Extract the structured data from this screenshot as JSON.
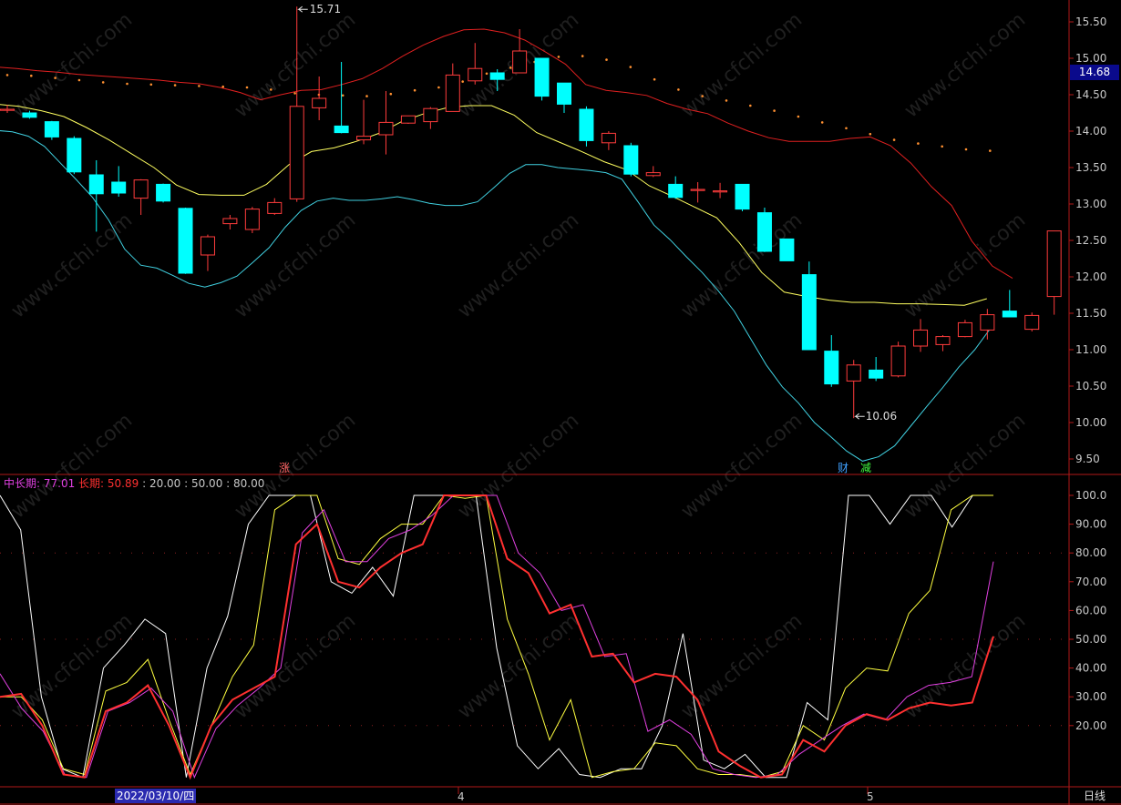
{
  "chart_data": [
    {
      "type": "candlestick",
      "y_ticks": [
        "9.50",
        "10.00",
        "10.50",
        "11.00",
        "11.50",
        "12.00",
        "12.50",
        "13.00",
        "13.50",
        "14.00",
        "14.50",
        "15.00",
        "15.50"
      ],
      "ylim": [
        9.3,
        15.75
      ],
      "current_price": "14.68",
      "annotations": {
        "high_label": "15.71",
        "low_label": "10.06"
      },
      "event_markers": [
        "涨",
        "财",
        "减"
      ],
      "colors": {
        "up": "#ff3c3c",
        "down": "#00ffff",
        "upper_band": "#e02020",
        "mid_line": "#ffff60",
        "lower_band": "#40d0e0",
        "dots": "#ff9030"
      },
      "candles": [
        {
          "o": 14.3,
          "h": 14.36,
          "l": 14.25,
          "c": 14.3
        },
        {
          "o": 14.25,
          "h": 14.28,
          "l": 14.17,
          "c": 14.19
        },
        {
          "o": 14.13,
          "h": 14.14,
          "l": 13.88,
          "c": 13.92
        },
        {
          "o": 13.9,
          "h": 13.93,
          "l": 13.41,
          "c": 13.44
        },
        {
          "o": 13.4,
          "h": 13.6,
          "l": 12.62,
          "c": 13.14
        },
        {
          "o": 13.3,
          "h": 13.52,
          "l": 13.1,
          "c": 13.15
        },
        {
          "o": 13.08,
          "h": 13.34,
          "l": 12.85,
          "c": 13.33
        },
        {
          "o": 13.27,
          "h": 13.28,
          "l": 13.02,
          "c": 13.04
        },
        {
          "o": 12.94,
          "h": 12.95,
          "l": 12.04,
          "c": 12.05
        },
        {
          "o": 12.3,
          "h": 12.58,
          "l": 12.08,
          "c": 12.55
        },
        {
          "o": 12.73,
          "h": 12.85,
          "l": 12.65,
          "c": 12.8
        },
        {
          "o": 12.65,
          "h": 12.96,
          "l": 12.6,
          "c": 12.93
        },
        {
          "o": 12.87,
          "h": 13.08,
          "l": 12.85,
          "c": 13.02
        },
        {
          "o": 13.07,
          "h": 15.71,
          "l": 13.03,
          "c": 14.34
        },
        {
          "o": 14.32,
          "h": 14.75,
          "l": 14.15,
          "c": 14.45
        },
        {
          "o": 14.07,
          "h": 14.95,
          "l": 13.97,
          "c": 13.98
        },
        {
          "o": 13.88,
          "h": 14.43,
          "l": 13.82,
          "c": 13.93
        },
        {
          "o": 13.95,
          "h": 14.55,
          "l": 13.68,
          "c": 14.12
        },
        {
          "o": 14.11,
          "h": 14.21,
          "l": 14.1,
          "c": 14.21
        },
        {
          "o": 14.13,
          "h": 14.33,
          "l": 14.03,
          "c": 14.31
        },
        {
          "o": 14.27,
          "h": 14.93,
          "l": 14.27,
          "c": 14.77
        },
        {
          "o": 14.69,
          "h": 15.21,
          "l": 14.64,
          "c": 14.86
        },
        {
          "o": 14.8,
          "h": 14.85,
          "l": 14.55,
          "c": 14.71
        },
        {
          "o": 14.8,
          "h": 15.4,
          "l": 14.8,
          "c": 15.1
        },
        {
          "o": 15.0,
          "h": 15.0,
          "l": 14.42,
          "c": 14.48
        },
        {
          "o": 14.66,
          "h": 14.66,
          "l": 14.25,
          "c": 14.37
        },
        {
          "o": 14.3,
          "h": 14.34,
          "l": 13.79,
          "c": 13.87
        },
        {
          "o": 13.84,
          "h": 14.0,
          "l": 13.74,
          "c": 13.97
        },
        {
          "o": 13.8,
          "h": 13.84,
          "l": 13.38,
          "c": 13.41
        },
        {
          "o": 13.39,
          "h": 13.52,
          "l": 13.37,
          "c": 13.43
        },
        {
          "o": 13.27,
          "h": 13.38,
          "l": 13.07,
          "c": 13.09
        },
        {
          "o": 13.2,
          "h": 13.3,
          "l": 13.02,
          "c": 13.2
        },
        {
          "o": 13.18,
          "h": 13.29,
          "l": 13.08,
          "c": 13.18
        },
        {
          "o": 13.27,
          "h": 13.27,
          "l": 12.9,
          "c": 12.93
        },
        {
          "o": 12.88,
          "h": 12.95,
          "l": 12.34,
          "c": 12.35
        },
        {
          "o": 12.52,
          "h": 12.52,
          "l": 12.22,
          "c": 12.22
        },
        {
          "o": 12.03,
          "h": 12.21,
          "l": 11.0,
          "c": 11.0
        },
        {
          "o": 10.98,
          "h": 11.2,
          "l": 10.49,
          "c": 10.53
        },
        {
          "o": 10.57,
          "h": 10.86,
          "l": 10.06,
          "c": 10.79
        },
        {
          "o": 10.72,
          "h": 10.9,
          "l": 10.57,
          "c": 10.61
        },
        {
          "o": 10.64,
          "h": 11.11,
          "l": 10.62,
          "c": 11.05
        },
        {
          "o": 11.05,
          "h": 11.42,
          "l": 10.97,
          "c": 11.27
        },
        {
          "o": 11.07,
          "h": 11.2,
          "l": 10.98,
          "c": 11.18
        },
        {
          "o": 11.18,
          "h": 11.41,
          "l": 11.17,
          "c": 11.37
        },
        {
          "o": 11.27,
          "h": 11.56,
          "l": 11.14,
          "c": 11.48
        },
        {
          "o": 11.53,
          "h": 11.82,
          "l": 11.45,
          "c": 11.45
        },
        {
          "o": 11.28,
          "h": 11.51,
          "l": 11.25,
          "c": 11.47
        },
        {
          "o": 11.73,
          "h": 12.63,
          "l": 11.48,
          "c": 12.63
        }
      ],
      "upper_band": [
        14.88,
        14.86,
        14.83,
        14.81,
        14.78,
        14.76,
        14.74,
        14.72,
        14.7,
        14.67,
        14.65,
        14.6,
        14.53,
        14.43,
        14.5,
        14.56,
        14.57,
        14.64,
        14.72,
        14.86,
        15.03,
        15.18,
        15.3,
        15.39,
        15.4,
        15.35,
        15.25,
        15.09,
        14.92,
        14.64,
        14.56,
        14.53,
        14.49,
        14.38,
        14.3,
        14.24,
        14.11,
        14.0,
        13.91,
        13.86,
        13.86,
        13.86,
        13.9,
        13.92,
        13.8,
        13.56,
        13.24,
        12.98,
        12.49,
        12.15,
        11.98
      ],
      "mid_line": [
        14.37,
        14.34,
        14.28,
        14.2,
        14.05,
        13.88,
        13.69,
        13.5,
        13.26,
        13.13,
        13.12,
        13.12,
        13.27,
        13.54,
        13.72,
        13.77,
        13.86,
        13.97,
        14.13,
        14.24,
        14.32,
        14.35,
        14.35,
        14.22,
        13.98,
        13.85,
        13.72,
        13.58,
        13.47,
        13.25,
        13.11,
        12.96,
        12.81,
        12.47,
        12.06,
        11.79,
        11.73,
        11.68,
        11.65,
        11.65,
        11.63,
        11.63,
        11.62,
        11.61,
        11.7
      ],
      "lower_band": [
        14.01,
        13.99,
        13.93,
        13.79,
        13.56,
        13.33,
        13.09,
        12.78,
        12.38,
        12.16,
        12.12,
        12.02,
        11.91,
        11.86,
        11.92,
        12.01,
        12.2,
        12.4,
        12.68,
        12.91,
        13.04,
        13.08,
        13.05,
        13.05,
        13.07,
        13.1,
        13.06,
        13.01,
        12.98,
        12.98,
        13.03,
        13.22,
        13.42,
        13.54,
        13.54,
        13.5,
        13.48,
        13.46,
        13.43,
        13.34,
        13.03,
        12.71,
        12.51,
        12.28,
        12.06,
        11.81,
        11.53,
        11.16,
        10.79,
        10.49,
        10.27,
        10.0,
        9.81,
        9.61,
        9.47,
        9.53,
        9.68,
        9.95,
        10.22,
        10.48,
        10.76,
        11.0,
        11.3
      ],
      "dot_line": [
        14.77,
        14.76,
        14.73,
        14.7,
        14.67,
        14.65,
        14.64,
        14.63,
        14.62,
        14.61,
        14.6,
        14.57,
        14.52,
        14.5,
        14.49,
        14.48,
        14.51,
        14.56,
        14.6,
        14.68,
        14.79,
        14.87,
        14.95,
        15.02,
        15.03,
        14.98,
        14.88,
        14.71,
        14.57,
        14.48,
        14.42,
        14.35,
        14.28,
        14.2,
        14.12,
        14.04,
        13.96,
        13.88,
        13.83,
        13.79,
        13.75,
        13.73
      ]
    },
    {
      "type": "line",
      "y_ticks": [
        "20.00",
        "30.00",
        "40.00",
        "50.00",
        "60.00",
        "70.00",
        "80.00",
        "90.00",
        "100.0"
      ],
      "ylim": [
        0,
        104
      ],
      "legend": [
        {
          "label": "中长期: 77.01",
          "color": "#e040e0"
        },
        {
          "label": "长期: 50.89",
          "color": "#ff3030"
        },
        {
          "label": ": 20.00 : 50.00 : 80.00",
          "color": "#c8c8c8"
        }
      ],
      "series": [
        {
          "color": "#ffffff",
          "width": 1,
          "values": [
            100,
            88,
            30,
            5,
            2,
            40,
            48,
            57,
            52,
            2,
            40,
            58,
            90,
            100,
            100,
            100,
            70,
            66,
            75,
            65,
            100,
            100,
            100,
            100,
            47,
            13,
            5,
            12,
            3,
            2,
            5,
            5,
            20,
            52,
            8,
            5,
            10,
            2,
            2,
            28,
            22,
            100,
            100,
            90,
            100,
            100,
            89,
            100,
            100
          ]
        },
        {
          "color": "#ffff40",
          "width": 1,
          "values": [
            30,
            30,
            22,
            5,
            3,
            32,
            35,
            43,
            22,
            3,
            20,
            37,
            48,
            95,
            100,
            100,
            78,
            76,
            85,
            90,
            90,
            100,
            99,
            100,
            57,
            38,
            15,
            29,
            2,
            4,
            5,
            14,
            13,
            5,
            3,
            3,
            2,
            4,
            20,
            15,
            33,
            40,
            39,
            59,
            67,
            95,
            100,
            100
          ]
        },
        {
          "color": "#e040e0",
          "width": 1,
          "values": [
            38,
            26,
            18,
            3,
            2,
            25,
            28,
            33,
            25,
            2,
            19,
            27,
            33,
            40,
            87,
            95,
            77,
            77,
            85,
            88,
            93,
            100,
            100,
            100,
            80,
            73,
            60,
            62,
            44,
            45,
            18,
            22,
            17,
            5,
            3,
            2,
            3,
            10,
            15,
            20,
            24,
            22,
            30,
            34,
            35,
            37,
            77
          ]
        },
        {
          "color": "#ff3030",
          "width": 2,
          "values": [
            30,
            31,
            20,
            3,
            2,
            25,
            28,
            34,
            20,
            2,
            20,
            29,
            33,
            37,
            83,
            90,
            70,
            68,
            75,
            80,
            83,
            100,
            100,
            100,
            78,
            73,
            59,
            62,
            44,
            45,
            35,
            38,
            37,
            29,
            11,
            6,
            2,
            3,
            15,
            11,
            20,
            24,
            22,
            26,
            28,
            27,
            28,
            51
          ]
        }
      ]
    }
  ],
  "date_label": "2022/03/10/四",
  "month_labels": [
    "4",
    "5"
  ],
  "period_label": "日线",
  "watermark": "www.cfchi.com"
}
